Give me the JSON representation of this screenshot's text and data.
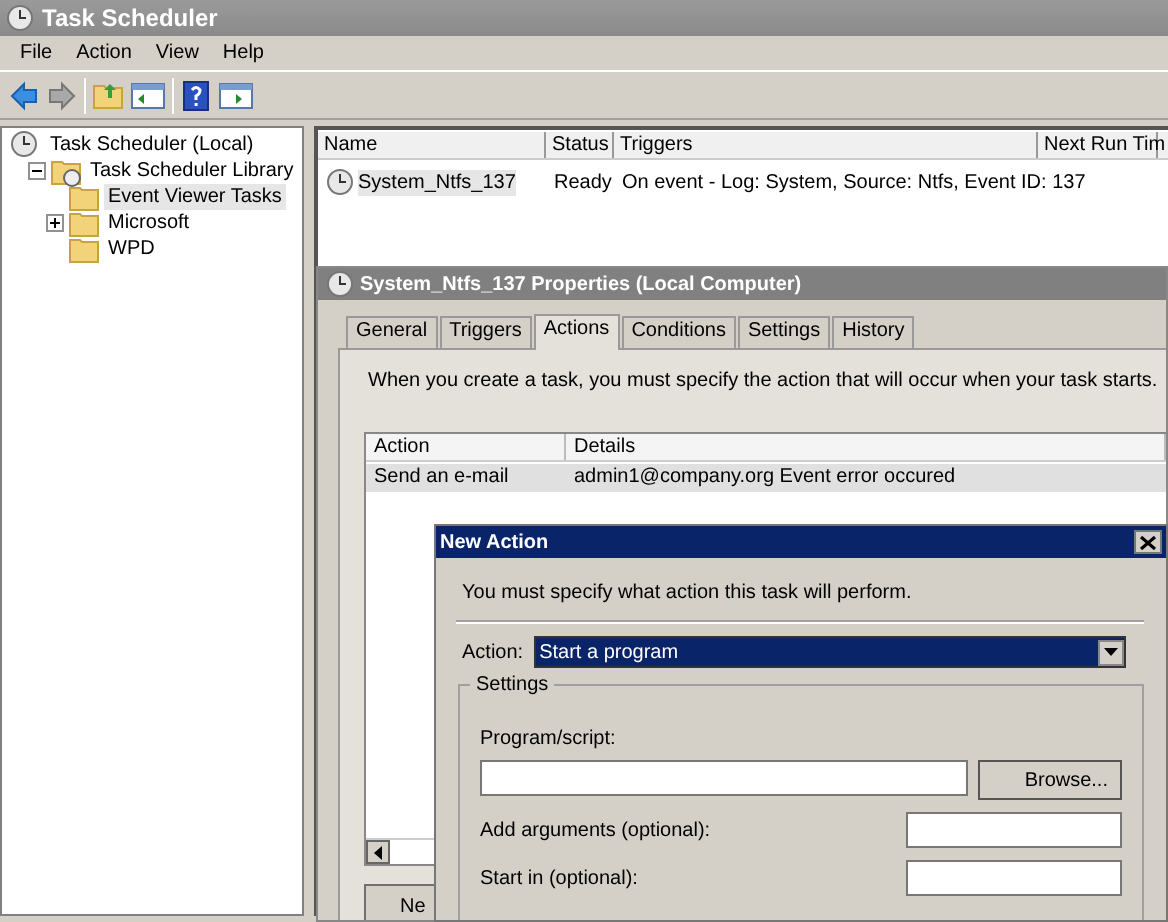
{
  "window": {
    "title": "Task Scheduler"
  },
  "menu": [
    "File",
    "Action",
    "View",
    "Help"
  ],
  "tree": [
    {
      "label": "Task Scheduler (Local)",
      "selected": false,
      "kind": "computer",
      "children": [
        {
          "label": "Task Scheduler Library",
          "selected": false,
          "kind": "library",
          "expanded": true,
          "children": [
            {
              "label": "Event Viewer Tasks",
              "selected": true,
              "kind": "folder"
            },
            {
              "label": "Microsoft",
              "selected": false,
              "kind": "folder",
              "expanded": false
            },
            {
              "label": "WPD",
              "selected": false,
              "kind": "folder"
            }
          ]
        }
      ]
    }
  ],
  "task_list": {
    "columns": [
      "Name",
      "Status",
      "Triggers",
      "Next Run Tim"
    ],
    "rows": [
      {
        "cells": [
          "System_Ntfs_137",
          "Ready",
          "On event - Log: System, Source: Ntfs, Event ID: 137"
        ],
        "selected": true
      }
    ]
  },
  "properties": {
    "title": "System_Ntfs_137 Properties (Local Computer)",
    "tabs": [
      {
        "label": "General",
        "selected": false
      },
      {
        "label": "Triggers",
        "selected": false
      },
      {
        "label": "Actions",
        "selected": true
      },
      {
        "label": "Conditions",
        "selected": false
      },
      {
        "label": "Settings",
        "selected": false
      },
      {
        "label": "History",
        "selected": false
      }
    ],
    "description": "When you create a task, you must specify the action that will occur when your task starts.",
    "columns": [
      "Action",
      "Details"
    ],
    "rows": [
      {
        "cells": [
          "Send an e-mail",
          "admin1@company.org Event error occured"
        ],
        "selected": true
      }
    ],
    "button": "Ne"
  },
  "new_action": {
    "title": "New Action",
    "description": "You must specify what action this task will perform.",
    "action_label": "Action:",
    "action_value": "Start a program",
    "settings_legend": "Settings",
    "fields": [
      {
        "label": "Program/script:",
        "kind": "wide",
        "button": "Browse..."
      },
      {
        "label": "Add arguments (optional):",
        "kind": "inline"
      },
      {
        "label": "Start in (optional):",
        "kind": "inline"
      }
    ]
  }
}
